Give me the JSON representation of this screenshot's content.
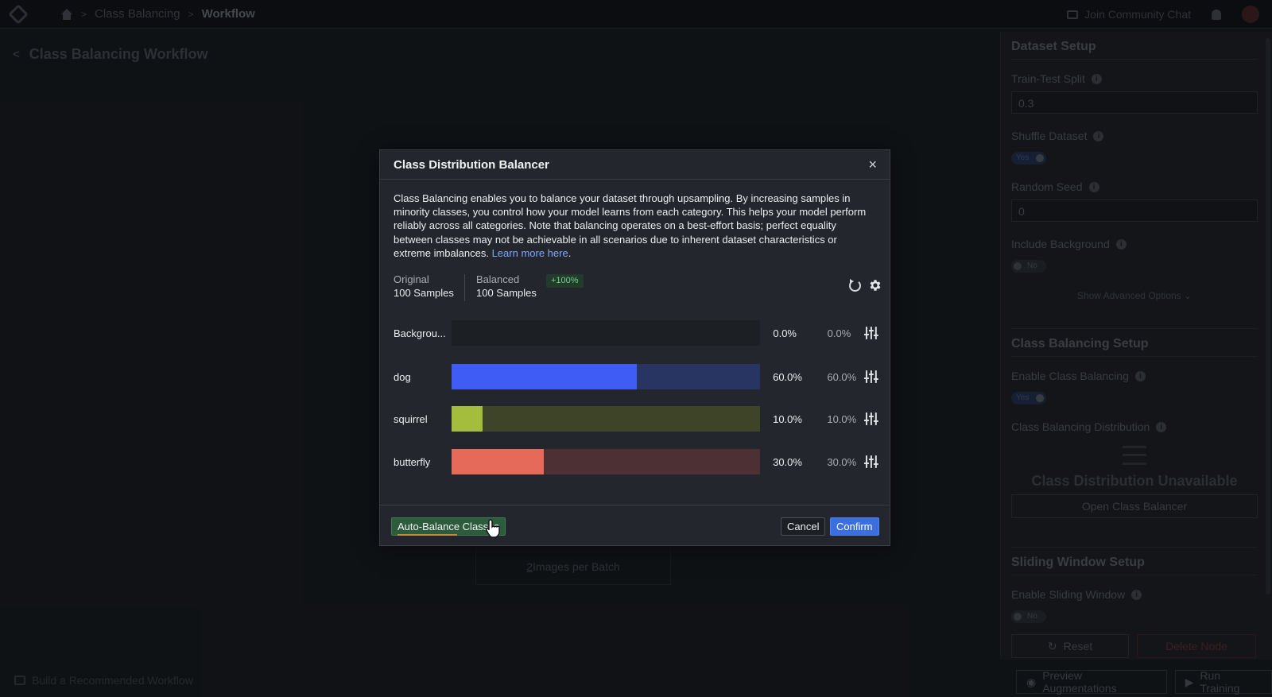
{
  "topbar": {
    "breadcrumbs": [
      "Class Balancing",
      "Workflow"
    ],
    "community_link": "Join Community Chat"
  },
  "page": {
    "title": "Class Balancing Workflow",
    "batch_count": "2",
    "batch_label": " Images per Batch",
    "bottom_link": "Build a Recommended Workflow"
  },
  "panel": {
    "dataset_setup": {
      "title": "Dataset Setup",
      "train_test_split_label": "Train-Test Split",
      "train_test_split_value": "0.3",
      "shuffle_label": "Shuffle Dataset",
      "shuffle_value": "Yes",
      "random_seed_label": "Random Seed",
      "random_seed_value": "0",
      "include_background_label": "Include Background",
      "include_background_value": "No",
      "advanced_link": "Show Advanced Options ⌄"
    },
    "class_balancing_setup": {
      "title": "Class Balancing Setup",
      "enable_label": "Enable Class Balancing",
      "enable_value": "Yes",
      "distribution_label": "Class Balancing Distribution",
      "unavailable_text": "Class Distribution Unavailable",
      "open_button": "Open Class Balancer"
    },
    "sliding_window_setup": {
      "title": "Sliding Window Setup",
      "enable_label": "Enable Sliding Window",
      "enable_value": "No"
    },
    "reset_button": "Reset",
    "delete_button": "Delete Node",
    "preview_button": "Preview Augmentations",
    "run_button": "Run Training"
  },
  "modal": {
    "title": "Class Distribution Balancer",
    "close_label": "×",
    "description": "Class Balancing enables you to balance your dataset through upsampling. By increasing samples in minority classes, you control how your model learns from each category. This helps your model perform reliably across all categories. Note that balancing operates on a best-effort basis; perfect equality between classes may not be achievable in all scenarios due to inherent dataset characteristics or extreme imbalances.",
    "learn_more": "Learn more here",
    "learn_more_suffix": ".",
    "original_label": "Original",
    "original_value": "100 Samples",
    "balanced_label": "Balanced",
    "balanced_value": "100 Samples",
    "change_badge": "+100%",
    "classes": [
      {
        "name": "Backgrou...",
        "original_pct": "0.0%",
        "balanced_pct": "0.0%",
        "fraction": 0.0,
        "color": "#3b6bff",
        "track": "#1c1f24"
      },
      {
        "name": "dog",
        "original_pct": "60.0%",
        "balanced_pct": "60.0%",
        "fraction": 0.6,
        "color": "#3f5cf5",
        "track": "#283461"
      },
      {
        "name": "squirrel",
        "original_pct": "10.0%",
        "balanced_pct": "10.0%",
        "fraction": 0.1,
        "color": "#a5bd3c",
        "track": "#3d4428"
      },
      {
        "name": "butterfly",
        "original_pct": "30.0%",
        "balanced_pct": "30.0%",
        "fraction": 0.3,
        "color": "#e66a5a",
        "track": "#4d3033"
      }
    ],
    "auto_balance_button": "Auto-Balance Classes",
    "cancel_button": "Cancel",
    "confirm_button": "Confirm"
  }
}
